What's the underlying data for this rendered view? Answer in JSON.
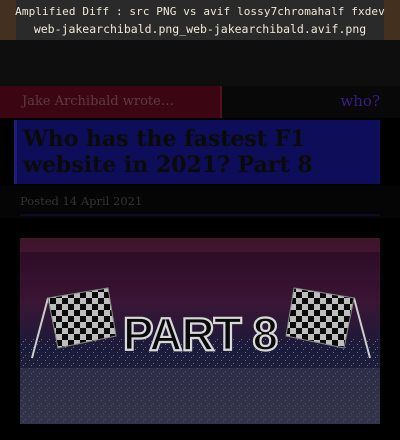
{
  "header": {
    "line1": "Amplified Diff : src PNG vs avif lossy7chromahalf fxdev",
    "line2": "web-jakearchibald.png_web-jakearchibald.avif.png"
  },
  "nav": {
    "author_link": "Jake Archibald wrote…",
    "who_link": "who?"
  },
  "article": {
    "title": "Who has the fastest F1 website in 2021? Part 8",
    "posted": "Posted 14 April 2021"
  },
  "hero": {
    "caption": "PART 8"
  }
}
